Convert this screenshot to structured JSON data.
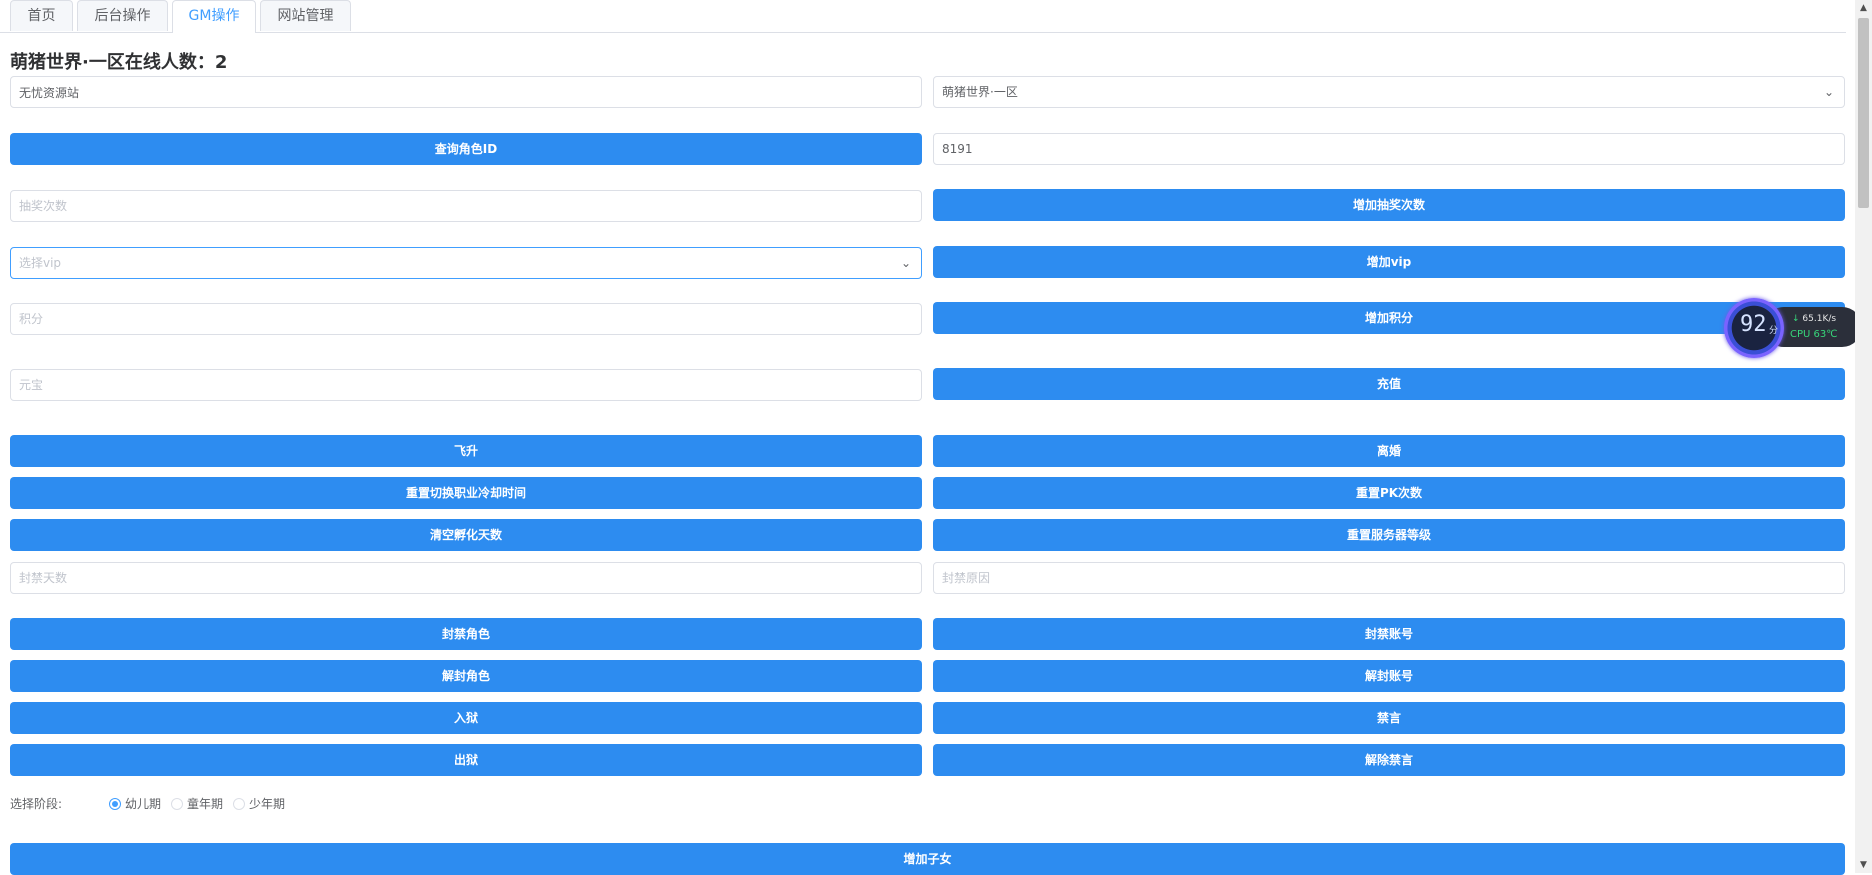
{
  "tabs": [
    {
      "label": "首页",
      "active": false
    },
    {
      "label": "后台操作",
      "active": false
    },
    {
      "label": "GM操作",
      "active": true
    },
    {
      "label": "网站管理",
      "active": false
    }
  ],
  "title": "萌猪世界·一区在线人数：2",
  "site_field": {
    "value": "无忧资源站"
  },
  "server_select": {
    "value": "萌猪世界·一区"
  },
  "query_role_button": "查询角色ID",
  "role_id_field": {
    "value": "8191"
  },
  "lottery_field": {
    "placeholder": "抽奖次数"
  },
  "add_lottery_button": "增加抽奖次数",
  "vip_select": {
    "placeholder": "选择vip"
  },
  "add_vip_button": "增加vip",
  "points_field": {
    "placeholder": "积分"
  },
  "add_points_button": "增加积分",
  "yuanbao_field": {
    "placeholder": "元宝"
  },
  "recharge_button": "充值",
  "ascend_button": "飞升",
  "divorce_button": "离婚",
  "reset_job_cooldown_button": "重置切换职业冷却时间",
  "reset_pk_button": "重置PK次数",
  "clear_hatch_button": "清空孵化天数",
  "reset_server_level_button": "重置服务器等级",
  "ban_days_field": {
    "placeholder": "封禁天数"
  },
  "ban_reason_field": {
    "placeholder": "封禁原因"
  },
  "ban_role_button": "封禁角色",
  "ban_account_button": "封禁账号",
  "unban_role_button": "解封角色",
  "unban_account_button": "解封账号",
  "jail_button": "入狱",
  "mute_button": "禁言",
  "release_button": "出狱",
  "unmute_button": "解除禁言",
  "stage": {
    "label": "选择阶段:",
    "options": [
      {
        "label": "幼儿期",
        "checked": true
      },
      {
        "label": "童年期",
        "checked": false
      },
      {
        "label": "少年期",
        "checked": false
      }
    ]
  },
  "add_child_button": "增加子女",
  "monitor": {
    "score": "92",
    "unit": "分",
    "net": "65.1K/s",
    "cpu": "CPU 63℃"
  },
  "icons": {
    "chevron": "chevron-down-icon",
    "arrow": "download-arrow-icon"
  },
  "colors": {
    "primary": "#2d8cf0",
    "accent": "#409eff"
  }
}
